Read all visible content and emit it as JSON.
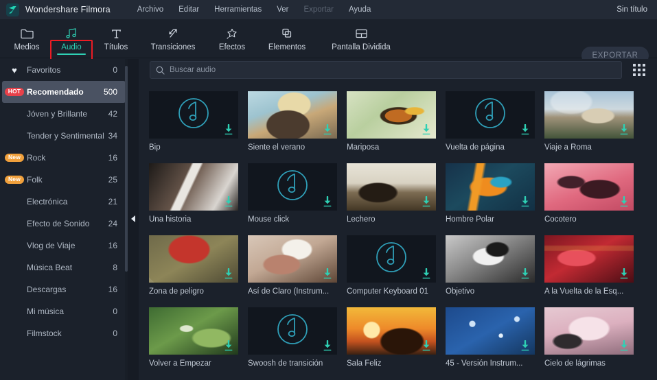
{
  "titlebar": {
    "app_name": "Wondershare Filmora",
    "logo_icon": "filmora-logo-icon",
    "menus": [
      {
        "label": "Archivo",
        "disabled": false
      },
      {
        "label": "Editar",
        "disabled": false
      },
      {
        "label": "Herramientas",
        "disabled": false
      },
      {
        "label": "Ver",
        "disabled": false
      },
      {
        "label": "Exportar",
        "disabled": true
      },
      {
        "label": "Ayuda",
        "disabled": false
      }
    ],
    "document_title": "Sin título"
  },
  "toolbar": {
    "tabs": [
      {
        "label": "Medios",
        "icon": "folder-icon",
        "active": false
      },
      {
        "label": "Audio",
        "icon": "music-notes-icon",
        "active": true
      },
      {
        "label": "Títulos",
        "icon": "text-t-icon",
        "active": false
      },
      {
        "label": "Transiciones",
        "icon": "transition-arrows-icon",
        "active": false
      },
      {
        "label": "Efectos",
        "icon": "sparkle-star-icon",
        "active": false
      },
      {
        "label": "Elementos",
        "icon": "layered-squares-icon",
        "active": false
      },
      {
        "label": "Pantalla Dividida",
        "icon": "split-screen-icon",
        "active": false
      }
    ],
    "export_label": "EXPORTAR",
    "accent_color": "#2fd0b4",
    "highlight_color": "#ec1c24"
  },
  "sidebar": {
    "items": [
      {
        "label": "Favoritos",
        "count": "0",
        "badge": "",
        "icon": "heart-icon",
        "selected": false
      },
      {
        "label": "Recomendado",
        "count": "500",
        "badge": "HOT",
        "badge_type": "hot",
        "icon": "",
        "selected": true
      },
      {
        "label": "Jóven y Brillante",
        "count": "42",
        "badge": "",
        "icon": "",
        "selected": false
      },
      {
        "label": "Tender y Sentimental",
        "count": "34",
        "badge": "",
        "icon": "",
        "selected": false
      },
      {
        "label": "Rock",
        "count": "16",
        "badge": "New",
        "badge_type": "new",
        "icon": "",
        "selected": false
      },
      {
        "label": "Folk",
        "count": "25",
        "badge": "New",
        "badge_type": "new",
        "icon": "",
        "selected": false
      },
      {
        "label": "Electrónica",
        "count": "21",
        "badge": "",
        "icon": "",
        "selected": false
      },
      {
        "label": "Efecto de Sonido",
        "count": "24",
        "badge": "",
        "icon": "",
        "selected": false
      },
      {
        "label": "Vlog de Viaje",
        "count": "16",
        "badge": "",
        "icon": "",
        "selected": false
      },
      {
        "label": "Música Beat",
        "count": "8",
        "badge": "",
        "icon": "",
        "selected": false
      },
      {
        "label": "Descargas",
        "count": "16",
        "badge": "",
        "icon": "",
        "selected": false
      },
      {
        "label": "Mi música",
        "count": "0",
        "badge": "",
        "icon": "",
        "selected": false
      },
      {
        "label": "Filmstock",
        "count": "0",
        "badge": "",
        "icon": "",
        "selected": false
      }
    ],
    "collapse_icon": "collapse-left-arrow-icon"
  },
  "search": {
    "placeholder": "Buscar audio",
    "value": "",
    "icon": "search-icon",
    "view_toggle_icon": "grid-view-icon"
  },
  "library": {
    "items": [
      {
        "label": "Bip",
        "art": "placeholder",
        "download_icon": "download-icon"
      },
      {
        "label": "Siente el verano",
        "art": "summer-hat-photo",
        "download_icon": "download-icon"
      },
      {
        "label": "Mariposa",
        "art": "butterfly-photo",
        "download_icon": "download-icon"
      },
      {
        "label": "Vuelta de página",
        "art": "placeholder",
        "download_icon": "download-icon"
      },
      {
        "label": "Viaje a Roma",
        "art": "rome-town-photo",
        "download_icon": "download-icon"
      },
      {
        "label": "Una historia",
        "art": "piano-hands-photo",
        "download_icon": "download-icon"
      },
      {
        "label": "Mouse click",
        "art": "placeholder",
        "download_icon": "download-icon"
      },
      {
        "label": "Lechero",
        "art": "cattle-field-photo",
        "download_icon": "download-icon"
      },
      {
        "label": "Hombre Polar",
        "art": "painted-face-photo",
        "download_icon": "download-icon"
      },
      {
        "label": "Cocotero",
        "art": "palm-pink-photo",
        "download_icon": "download-icon"
      },
      {
        "label": "Zona de peligro",
        "art": "danger-sign-photo",
        "download_icon": "download-icon"
      },
      {
        "label": "Así de Claro (Instrum...",
        "art": "flower-face-photo",
        "download_icon": "download-icon"
      },
      {
        "label": "Computer Keyboard 01",
        "art": "placeholder",
        "download_icon": "download-icon"
      },
      {
        "label": "Objetivo",
        "art": "bw-woman-photo",
        "download_icon": "download-icon"
      },
      {
        "label": "A la Vuelta de la Esq...",
        "art": "neon-red-photo",
        "download_icon": "download-icon"
      },
      {
        "label": "Volver a Empezar",
        "art": "fern-spiral-photo",
        "download_icon": "download-icon"
      },
      {
        "label": "Swoosh de transición",
        "art": "placeholder",
        "download_icon": "download-icon"
      },
      {
        "label": "Sala Feliz",
        "art": "sunset-couple-photo",
        "download_icon": "download-icon"
      },
      {
        "label": "45 - Versión Instrum...",
        "art": "blue-bubbles-photo",
        "download_icon": "download-icon"
      },
      {
        "label": "Cielo de lágrimas",
        "art": "pink-cloud-photo",
        "download_icon": "download-icon"
      }
    ]
  }
}
